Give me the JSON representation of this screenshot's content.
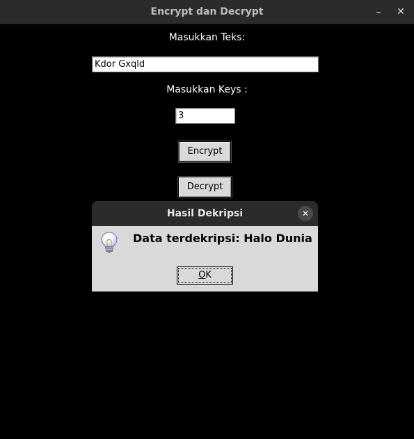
{
  "window": {
    "title": "Encrypt dan Decrypt",
    "minimize_icon": "minimize-icon",
    "minimize_glyph": "–",
    "close_icon": "close-icon",
    "close_glyph": "✕"
  },
  "form": {
    "text_label": "Masukkan Teks:",
    "text_value": "Kdor Gxqld",
    "keys_label": "Masukkan Keys :",
    "keys_value": "3",
    "encrypt_label": "Encrypt",
    "decrypt_label": "Decrypt"
  },
  "dialog": {
    "title": "Hasil Dekripsi",
    "close_glyph": "✕",
    "icon": "lightbulb-icon",
    "message": "Data terdekripsi: Halo Dunia",
    "ok_mnemonic": "O",
    "ok_rest": "K"
  },
  "colors": {
    "window_background": "#000000",
    "titlebar": "#2b2b2b",
    "dialog_body": "#d9d9d9",
    "button_face": "#d9d9d9"
  }
}
